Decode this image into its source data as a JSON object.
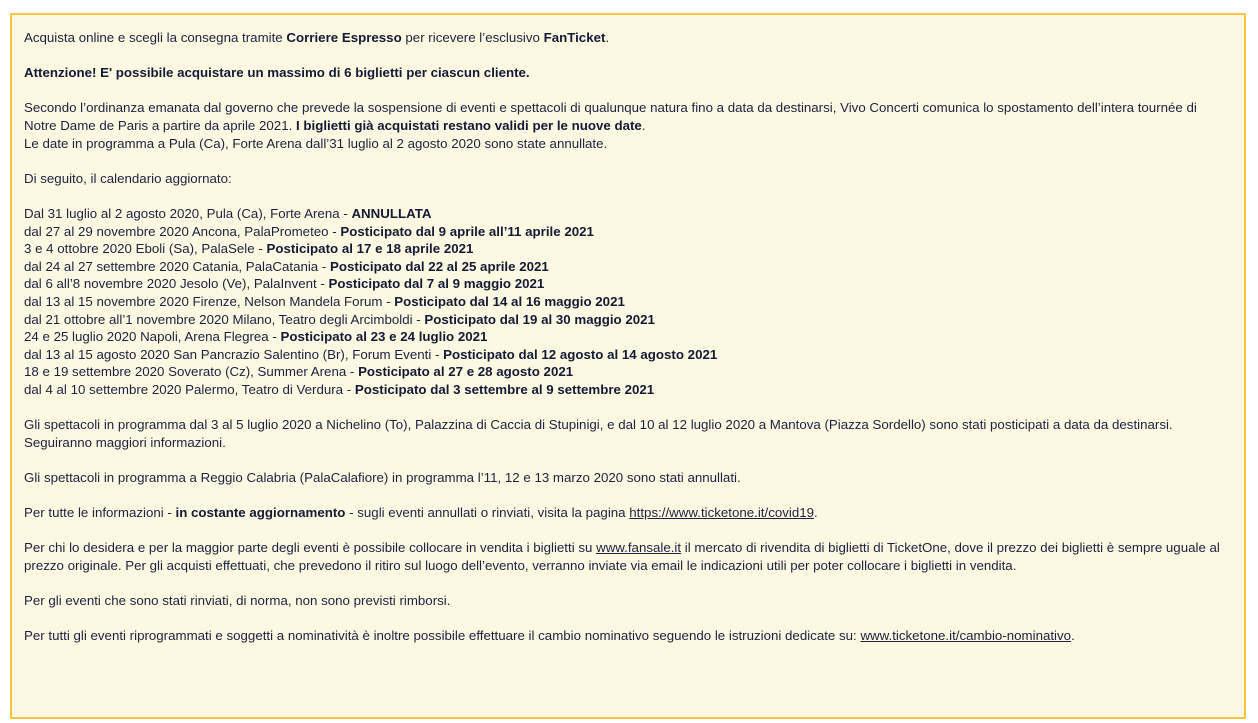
{
  "intro": {
    "before": "Acquista online e scegli la consegna tramite ",
    "courier": "Corriere Espresso",
    "middle": " per ricevere l’esclusivo ",
    "fanticket": "FanTicket",
    "after": "."
  },
  "warning": "Attenzione! E' possibile acquistare un massimo di 6 biglietti per ciascun cliente.",
  "ordinance": {
    "text": "Secondo l’ordinanza emanata dal governo che prevede la sospensione di eventi e spettacoli di qualunque natura fino a data da destinarsi, Vivo Concerti comunica lo spostamento dell’intera tournée di Notre Dame de Paris a partire da aprile 2021. ",
    "bold": "I biglietti già acquistati restano validi per le nuove date",
    "period": ".",
    "cancelled": "Le date in programma a Pula (Ca), Forte Arena dall’31 luglio al 2 agosto 2020 sono state annullate."
  },
  "calendar_intro": "Di seguito, il calendario aggiornato:",
  "dates": [
    {
      "event": "Dal 31 luglio al 2 agosto 2020, Pula (Ca), Forte Arena - ",
      "status": "ANNULLATA"
    },
    {
      "event": "dal 27 al 29 novembre 2020 Ancona, PalaPrometeo - ",
      "status": "Posticipato dal 9 aprile all’11 aprile 2021"
    },
    {
      "event": "3 e 4 ottobre 2020 Eboli (Sa), PalaSele - ",
      "status": "Posticipato al 17 e 18 aprile 2021"
    },
    {
      "event": "dal 24 al 27 settembre 2020 Catania, PalaCatania - ",
      "status": "Posticipato dal 22 al 25 aprile 2021"
    },
    {
      "event": "dal 6 all’8 novembre 2020 Jesolo (Ve), PalaInvent - ",
      "status": "Posticipato dal 7 al 9 maggio 2021"
    },
    {
      "event": "dal 13 al 15 novembre 2020 Firenze, Nelson Mandela Forum - ",
      "status": "Posticipato dal 14 al 16 maggio 2021"
    },
    {
      "event": "dal 21 ottobre all’1 novembre 2020 Milano, Teatro degli Arcimboldi - ",
      "status": "Posticipato dal 19 al 30 maggio 2021"
    },
    {
      "event": "24 e 25 luglio 2020 Napoli, Arena Flegrea - ",
      "status": "Posticipato al 23 e 24 luglio 2021"
    },
    {
      "event": "dal 13 al 15 agosto 2020 San Pancrazio Salentino (Br), Forum Eventi - ",
      "status": "Posticipato dal 12 agosto al 14 agosto 2021"
    },
    {
      "event": "18 e 19 settembre 2020 Soverato (Cz), Summer Arena - ",
      "status": "Posticipato al 27 e 28 agosto 2021"
    },
    {
      "event": "dal 4 al 10 settembre 2020 Palermo, Teatro di Verdura - ",
      "status": "Posticipato dal 3 settembre al 9 settembre 2021"
    }
  ],
  "postponed_note": "Gli spettacoli in programma dal 3 al 5 luglio 2020 a Nichelino (To), Palazzina di Caccia di Stupinigi, e dal 10 al 12 luglio 2020 a Mantova (Piazza Sordello) sono stati posticipati a data da destinarsi. Seguiranno maggiori informazioni.",
  "reggio_note": "Gli spettacoli in programma a Reggio Calabria (PalaCalafiore) in programma l’11, 12 e 13 marzo 2020 sono stati annullati.",
  "info": {
    "before": "Per tutte le informazioni - ",
    "bold": "in costante aggiornamento",
    "after": " - sugli eventi annullati o rinviati, visita la pagina ",
    "link": "https://www.ticketone.it/covid19",
    "end": "."
  },
  "resale": {
    "before": "Per chi lo desidera e per la maggior parte degli eventi è possibile collocare in vendita i biglietti su ",
    "link": "www.fansale.it",
    "after": " il mercato di rivendita di biglietti di TicketOne, dove il prezzo dei biglietti è sempre uguale al prezzo originale. Per gli acquisti effettuati, che prevedono il ritiro sul luogo dell’evento, verranno inviate via email le indicazioni utili per poter collocare i biglietti in vendita."
  },
  "refund_note": "Per gli eventi che sono stati rinviati, di norma, non sono previsti rimborsi.",
  "name_change": {
    "before": "Per tutti gli eventi riprogrammati e soggetti a nominatività è inoltre possibile effettuare il cambio nominativo seguendo le istruzioni dedicate su: ",
    "link": "www.ticketone.it/cambio-nominativo",
    "end": "."
  },
  "colors": {
    "background": "#fdf8e1",
    "border": "#f5c443",
    "text": "#1b2240"
  }
}
